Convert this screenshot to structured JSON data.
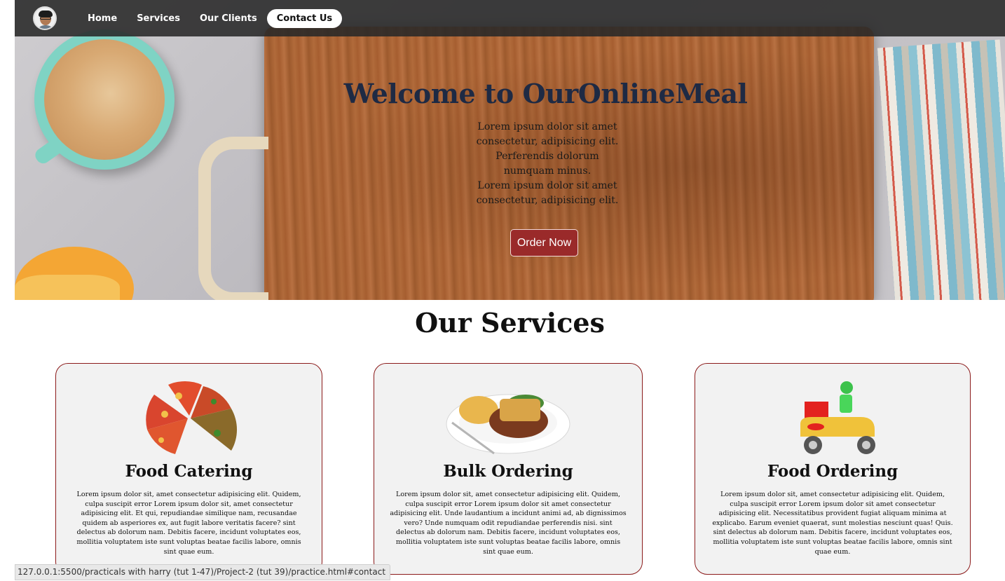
{
  "nav": {
    "items": [
      {
        "label": "Home"
      },
      {
        "label": "Services"
      },
      {
        "label": "Our Clients"
      },
      {
        "label": "Contact Us",
        "active": true
      }
    ]
  },
  "hero": {
    "title": "Welcome to OurOnlineMeal",
    "text_1": "Lorem ipsum dolor sit amet consectetur, adipisicing elit. Perferendis dolorum numquam minus.",
    "text_2": "Lorem ipsum dolor sit amet consectetur, adipisicing elit.",
    "button": "Order Now"
  },
  "services": {
    "title": "Our Services",
    "cards": [
      {
        "title": "Food Catering",
        "icon": "pizza-slices-image",
        "text": "Lorem ipsum dolor sit, amet consectetur adipisicing elit. Quidem, culpa suscipit error Lorem ipsum dolor sit, amet consectetur adipisicing elit. Et qui, repudiandae similique nam, recusandae quidem ab asperiores ex, aut fugit labore veritatis facere? sint delectus ab dolorum nam. Debitis facere, incidunt voluptates eos, mollitia voluptatem iste sunt voluptas beatae facilis labore, omnis sint quae eum."
      },
      {
        "title": "Bulk Ordering",
        "icon": "meal-plate-image",
        "text": "Lorem ipsum dolor sit, amet consectetur adipisicing elit. Quidem, culpa suscipit error Lorem ipsum dolor sit amet consectetur adipisicing elit. Unde laudantium a incidunt animi ad, ab dignissimos vero? Unde numquam odit repudiandae perferendis nisi. sint delectus ab dolorum nam. Debitis facere, incidunt voluptates eos, mollitia voluptatem iste sunt voluptas beatae facilis labore, omnis sint quae eum."
      },
      {
        "title": "Food Ordering",
        "icon": "delivery-scooter-image",
        "text": "Lorem ipsum dolor sit, amet consectetur adipisicing elit. Quidem, culpa suscipit error Lorem ipsum dolor sit amet consectetur adipisicing elit. Necessitatibus provident fugiat aliquam minima at explicabo. Earum eveniet quaerat, sunt molestias nesciunt quas! Quis. sint delectus ab dolorum nam. Debitis facere, incidunt voluptates eos, mollitia voluptatem iste sunt voluptas beatae facilis labore, omnis sint quae eum."
      }
    ]
  },
  "status_bar": {
    "url": "127.0.0.1:5500/practicals with harry (tut 1-47)/Project-2 (tut 39)/practice.html#contact"
  },
  "colors": {
    "nav_bg": "#282828",
    "accent_button": "#9a2a2a",
    "card_border": "#8b1a1a",
    "hero_title": "#1e2a44"
  }
}
